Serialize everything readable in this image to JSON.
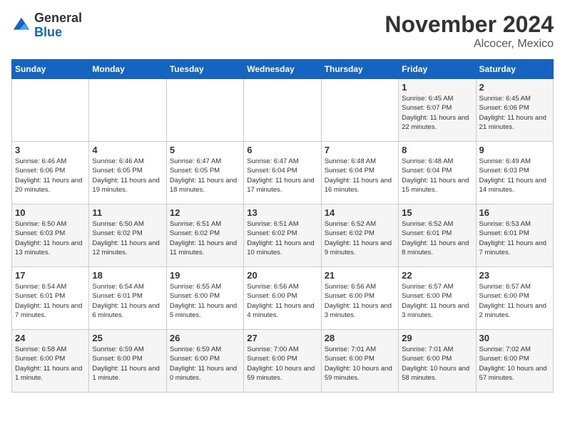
{
  "header": {
    "logo_general": "General",
    "logo_blue": "Blue",
    "month_title": "November 2024",
    "location": "Alcocer, Mexico"
  },
  "days_of_week": [
    "Sunday",
    "Monday",
    "Tuesday",
    "Wednesday",
    "Thursday",
    "Friday",
    "Saturday"
  ],
  "weeks": [
    [
      {
        "day": "",
        "detail": ""
      },
      {
        "day": "",
        "detail": ""
      },
      {
        "day": "",
        "detail": ""
      },
      {
        "day": "",
        "detail": ""
      },
      {
        "day": "",
        "detail": ""
      },
      {
        "day": "1",
        "detail": "Sunrise: 6:45 AM\nSunset: 6:07 PM\nDaylight: 11 hours and 22 minutes."
      },
      {
        "day": "2",
        "detail": "Sunrise: 6:45 AM\nSunset: 6:06 PM\nDaylight: 11 hours and 21 minutes."
      }
    ],
    [
      {
        "day": "3",
        "detail": "Sunrise: 6:46 AM\nSunset: 6:06 PM\nDaylight: 11 hours and 20 minutes."
      },
      {
        "day": "4",
        "detail": "Sunrise: 6:46 AM\nSunset: 6:05 PM\nDaylight: 11 hours and 19 minutes."
      },
      {
        "day": "5",
        "detail": "Sunrise: 6:47 AM\nSunset: 6:05 PM\nDaylight: 11 hours and 18 minutes."
      },
      {
        "day": "6",
        "detail": "Sunrise: 6:47 AM\nSunset: 6:04 PM\nDaylight: 11 hours and 17 minutes."
      },
      {
        "day": "7",
        "detail": "Sunrise: 6:48 AM\nSunset: 6:04 PM\nDaylight: 11 hours and 16 minutes."
      },
      {
        "day": "8",
        "detail": "Sunrise: 6:48 AM\nSunset: 6:04 PM\nDaylight: 11 hours and 15 minutes."
      },
      {
        "day": "9",
        "detail": "Sunrise: 6:49 AM\nSunset: 6:03 PM\nDaylight: 11 hours and 14 minutes."
      }
    ],
    [
      {
        "day": "10",
        "detail": "Sunrise: 6:50 AM\nSunset: 6:03 PM\nDaylight: 11 hours and 13 minutes."
      },
      {
        "day": "11",
        "detail": "Sunrise: 6:50 AM\nSunset: 6:02 PM\nDaylight: 11 hours and 12 minutes."
      },
      {
        "day": "12",
        "detail": "Sunrise: 6:51 AM\nSunset: 6:02 PM\nDaylight: 11 hours and 11 minutes."
      },
      {
        "day": "13",
        "detail": "Sunrise: 6:51 AM\nSunset: 6:02 PM\nDaylight: 11 hours and 10 minutes."
      },
      {
        "day": "14",
        "detail": "Sunrise: 6:52 AM\nSunset: 6:02 PM\nDaylight: 11 hours and 9 minutes."
      },
      {
        "day": "15",
        "detail": "Sunrise: 6:52 AM\nSunset: 6:01 PM\nDaylight: 11 hours and 8 minutes."
      },
      {
        "day": "16",
        "detail": "Sunrise: 6:53 AM\nSunset: 6:01 PM\nDaylight: 11 hours and 7 minutes."
      }
    ],
    [
      {
        "day": "17",
        "detail": "Sunrise: 6:54 AM\nSunset: 6:01 PM\nDaylight: 11 hours and 7 minutes."
      },
      {
        "day": "18",
        "detail": "Sunrise: 6:54 AM\nSunset: 6:01 PM\nDaylight: 11 hours and 6 minutes."
      },
      {
        "day": "19",
        "detail": "Sunrise: 6:55 AM\nSunset: 6:00 PM\nDaylight: 11 hours and 5 minutes."
      },
      {
        "day": "20",
        "detail": "Sunrise: 6:56 AM\nSunset: 6:00 PM\nDaylight: 11 hours and 4 minutes."
      },
      {
        "day": "21",
        "detail": "Sunrise: 6:56 AM\nSunset: 6:00 PM\nDaylight: 11 hours and 3 minutes."
      },
      {
        "day": "22",
        "detail": "Sunrise: 6:57 AM\nSunset: 6:00 PM\nDaylight: 11 hours and 3 minutes."
      },
      {
        "day": "23",
        "detail": "Sunrise: 6:57 AM\nSunset: 6:00 PM\nDaylight: 11 hours and 2 minutes."
      }
    ],
    [
      {
        "day": "24",
        "detail": "Sunrise: 6:58 AM\nSunset: 6:00 PM\nDaylight: 11 hours and 1 minute."
      },
      {
        "day": "25",
        "detail": "Sunrise: 6:59 AM\nSunset: 6:00 PM\nDaylight: 11 hours and 1 minute."
      },
      {
        "day": "26",
        "detail": "Sunrise: 6:59 AM\nSunset: 6:00 PM\nDaylight: 11 hours and 0 minutes."
      },
      {
        "day": "27",
        "detail": "Sunrise: 7:00 AM\nSunset: 6:00 PM\nDaylight: 10 hours and 59 minutes."
      },
      {
        "day": "28",
        "detail": "Sunrise: 7:01 AM\nSunset: 6:00 PM\nDaylight: 10 hours and 59 minutes."
      },
      {
        "day": "29",
        "detail": "Sunrise: 7:01 AM\nSunset: 6:00 PM\nDaylight: 10 hours and 58 minutes."
      },
      {
        "day": "30",
        "detail": "Sunrise: 7:02 AM\nSunset: 6:00 PM\nDaylight: 10 hours and 57 minutes."
      }
    ]
  ]
}
